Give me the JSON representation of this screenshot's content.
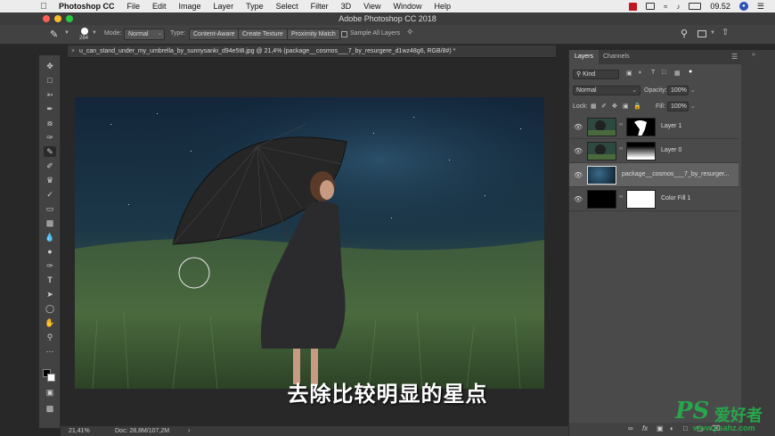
{
  "menubar": {
    "app_name": "Photoshop CC",
    "items": [
      "File",
      "Edit",
      "Image",
      "Layer",
      "Type",
      "Select",
      "Filter",
      "3D",
      "View",
      "Window",
      "Help"
    ],
    "clock": "09.52"
  },
  "window": {
    "title": "Adobe Photoshop CC 2018"
  },
  "options": {
    "brush_size": "284",
    "mode_label": "Mode:",
    "mode_value": "Normal",
    "type_label": "Type:",
    "type_buttons": [
      "Content-Aware",
      "Create Texture",
      "Proximity Match"
    ],
    "sample_all_layers": "Sample All Layers"
  },
  "document": {
    "tab_title": "u_can_stand_under_my_umbrella_by_sunnysanki_d94e5t8.jpg @ 21,4% (package__cosmos___7_by_resurgere_d1wz48g6, RGB/8#) *",
    "zoom": "21,41%",
    "doc_info": "Doc: 28,8M/107,2M"
  },
  "subtitle": "去除比较明显的星点",
  "layers_panel": {
    "tabs": [
      "Layers",
      "Channels"
    ],
    "filter_kind": "Kind",
    "blend_mode": "Normal",
    "opacity_label": "Opacity:",
    "opacity_value": "100%",
    "lock_label": "Lock:",
    "fill_label": "Fill:",
    "fill_value": "100%",
    "layers": [
      {
        "name": "Layer 1"
      },
      {
        "name": "Layer 0"
      },
      {
        "name": "package__cosmos___7_by_resurger..."
      },
      {
        "name": "Color Fill 1"
      }
    ],
    "footer_icons": [
      "link-icon",
      "fx-icon",
      "mask-icon",
      "adjustment-icon",
      "folder-icon",
      "new-layer-icon",
      "trash-icon"
    ]
  },
  "watermark": {
    "brand": "PS",
    "cn": "爱好者",
    "url": "www.psahz.com"
  },
  "colors": {
    "ui_dark": "#282828",
    "panel": "#4a4a4a",
    "watermark_green": "#27a64a",
    "mac_red": "#c0161e"
  }
}
